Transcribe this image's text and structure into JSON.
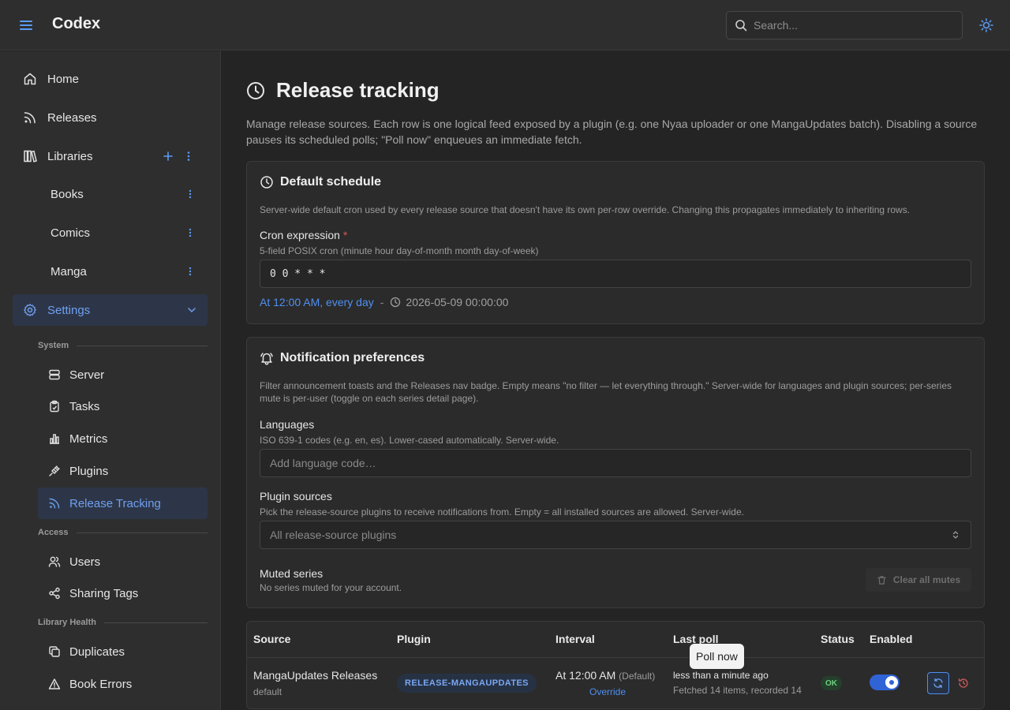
{
  "app": {
    "title": "Codex",
    "search_placeholder": "Search...",
    "icons": [
      "menu-icon",
      "search-icon",
      "sun-icon"
    ]
  },
  "sidebar": {
    "home": "Home",
    "releases": "Releases",
    "libraries": "Libraries",
    "library_items": [
      "Books",
      "Comics",
      "Manga"
    ],
    "settings": "Settings",
    "system_label": "System",
    "system_items": [
      "Server",
      "Tasks",
      "Metrics",
      "Plugins",
      "Release Tracking"
    ],
    "access_label": "Access",
    "access_items": [
      "Users",
      "Sharing Tags"
    ],
    "health_label": "Library Health",
    "health_items": [
      "Duplicates",
      "Book Errors"
    ]
  },
  "page": {
    "title": "Release tracking",
    "description": "Manage release sources. Each row is one logical feed exposed by a plugin (e.g. one Nyaa uploader or one MangaUpdates batch). Disabling a source pauses its scheduled polls; \"Poll now\" enqueues an immediate fetch."
  },
  "default_schedule": {
    "title": "Default schedule",
    "description": "Server-wide default cron used by every release source that doesn't have its own per-row override. Changing this propagates immediately to inheriting rows.",
    "cron_label": "Cron expression",
    "required_mark": "*",
    "cron_hint": "5-field POSIX cron (minute hour day-of-month month day-of-week)",
    "cron_value": "0 0 * * *",
    "human_readable": "At 12:00 AM, every day",
    "separator": "-",
    "next_run": "2026-05-09 00:00:00"
  },
  "notifications": {
    "title": "Notification preferences",
    "description": "Filter announcement toasts and the Releases nav badge. Empty means \"no filter — let everything through.\" Server-wide for languages and plugin sources; per-series mute is per-user (toggle on each series detail page).",
    "languages_label": "Languages",
    "languages_hint": "ISO 639-1 codes (e.g. en, es). Lower-cased automatically. Server-wide.",
    "languages_placeholder": "Add language code…",
    "plugin_sources_label": "Plugin sources",
    "plugin_sources_hint": "Pick the release-source plugins to receive notifications from. Empty = all installed sources are allowed. Server-wide.",
    "plugin_sources_placeholder": "All release-source plugins",
    "muted_label": "Muted series",
    "muted_hint": "No series muted for your account.",
    "clear_mutes": "Clear all mutes"
  },
  "sources_table": {
    "columns": [
      "Source",
      "Plugin",
      "Interval",
      "Last poll",
      "Status",
      "Enabled"
    ],
    "rows": [
      {
        "source": "MangaUpdates Releases",
        "source_sub": "default",
        "plugin": "RELEASE-MANGAUPDATES",
        "interval": "At 12:00 AM",
        "interval_note": "(Default)",
        "override": "Override",
        "last_poll": "less than a minute ago",
        "last_poll_detail": "Fetched 14 items, recorded 14",
        "status": "OK",
        "enabled": true
      }
    ],
    "tooltip": "Poll now"
  }
}
